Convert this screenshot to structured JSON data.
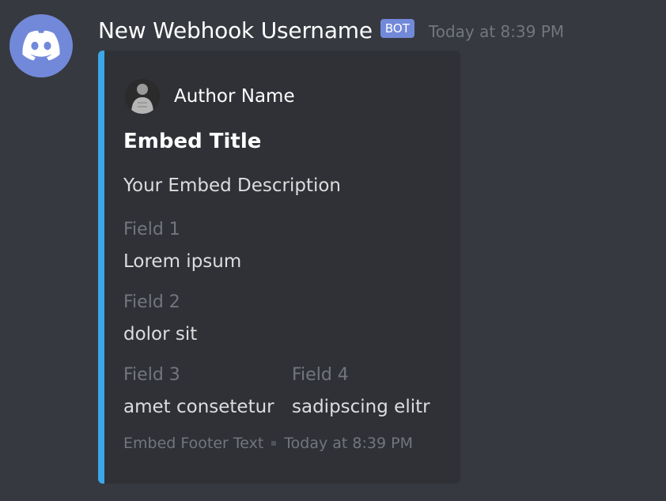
{
  "message": {
    "username": "New Webhook Username",
    "bot_tag": "BOT",
    "timestamp": "Today at 8:39 PM"
  },
  "embed": {
    "color": "#3ba7e9",
    "author_name": "Author Name",
    "title": "Embed Title",
    "description": "Your Embed Description",
    "fields": [
      {
        "name": "Field 1",
        "value": "Lorem ipsum"
      },
      {
        "name": "Field 2",
        "value": "dolor sit"
      },
      {
        "name": "Field 3",
        "value": "amet consetetur"
      },
      {
        "name": "Field 4",
        "value": "sadipscing elitr"
      }
    ],
    "footer_text": "Embed Footer Text",
    "footer_timestamp": "Today at 8:39 PM"
  },
  "colors": {
    "background": "#36393f",
    "embed_background": "#2f3136",
    "avatar_blurple": "#7289da",
    "muted_text": "#72767d"
  },
  "icons": {
    "avatar": "discord-logo-icon",
    "author_icon": "author-photo-icon"
  }
}
